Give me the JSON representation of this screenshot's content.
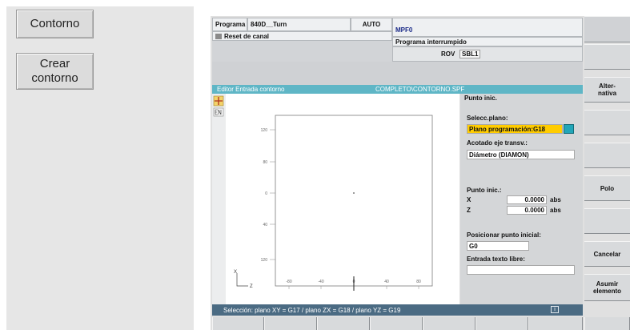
{
  "left_buttons": {
    "contour": "Contorno",
    "create_contour_line1": "Crear",
    "create_contour_line2": "contorno"
  },
  "header": {
    "program_label": "Programa",
    "program_name": "840D__Turn",
    "mode": "AUTO",
    "file": "MPF0",
    "channel_reset": "Reset de canal",
    "program_status": "Programa interrumpido",
    "rov": "ROV",
    "sbl": "SBL1"
  },
  "editor": {
    "title": "Editor  Entrada contorno",
    "file_path": "COMPLETO\\CONTORNO.SPF"
  },
  "plot": {
    "y_ticks": [
      "120",
      "80",
      "0",
      "40",
      "120"
    ],
    "x_ticks": [
      "-80",
      "-40",
      "0",
      "40",
      "80"
    ],
    "axis_x_label": "Z",
    "axis_y_label": "X"
  },
  "form": {
    "section": "Punto inic.",
    "plane_label": "Selecc.plano:",
    "plane_value": "Plano programación:G18",
    "dim_label": "Acotado eje transv.:",
    "dim_value": "Diámetro (DIAMON)",
    "start_label": "Punto inic.:",
    "x_label": "X",
    "x_value": "0.0000",
    "x_unit": "abs",
    "z_label": "Z",
    "z_value": "0.0000",
    "z_unit": "abs",
    "position_label": "Posicionar punto inicial:",
    "position_value": "G0",
    "free_text_label": "Entrada texto libre:",
    "free_text_value": ""
  },
  "status_bar": {
    "text": "Selección: plano XY = G17 / plano ZX = G18 / plano YZ = G19",
    "indicator": "i"
  },
  "softkeys": {
    "alternative_line1": "Alter-",
    "alternative_line2": "nativa",
    "pole": "Polo",
    "cancel": "Cancelar",
    "accept_line1": "Asumir",
    "accept_line2": "elemento"
  }
}
